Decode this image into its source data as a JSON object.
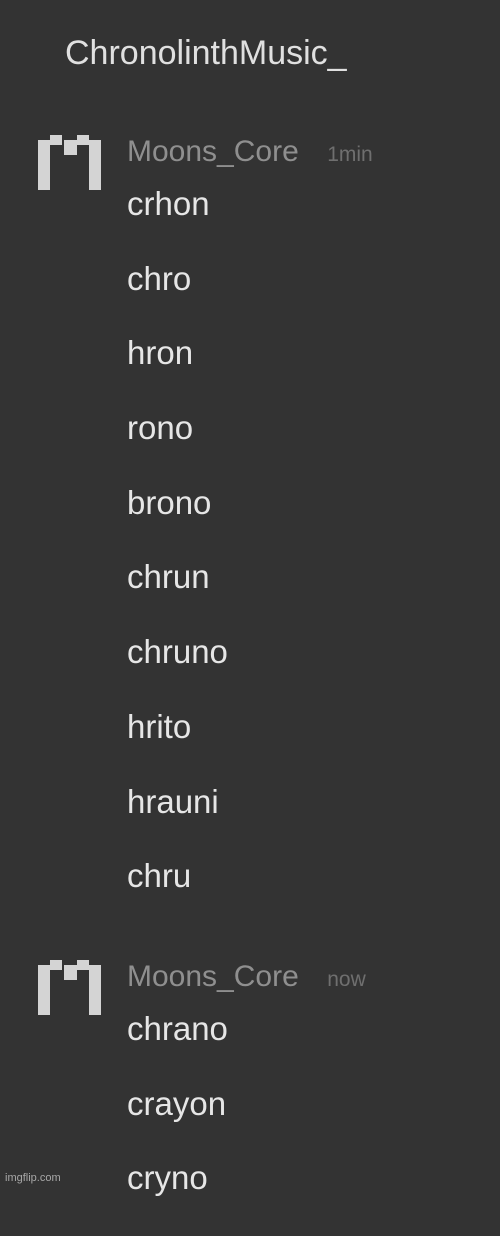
{
  "channel": {
    "title": "ChronolinthMusic_"
  },
  "messages": [
    {
      "username": "Moons_Core",
      "timestamp": "1min",
      "avatar_icon": "pixel-m-icon",
      "lines": [
        "crhon",
        "chro",
        "hron",
        "rono",
        "brono",
        "chrun",
        "chruno",
        "hrito",
        "hrauni",
        "chru"
      ]
    },
    {
      "username": "Moons_Core",
      "timestamp": "now",
      "avatar_icon": "pixel-m-icon",
      "lines": [
        "chrano",
        "crayon",
        "cryno"
      ]
    }
  ],
  "watermark": "imgflip.com",
  "colors": {
    "background": "#333333",
    "text": "#e6e6e6",
    "username": "#8f8f8f",
    "timestamp": "#6f6f6f",
    "avatar": "#d4d4d4"
  }
}
